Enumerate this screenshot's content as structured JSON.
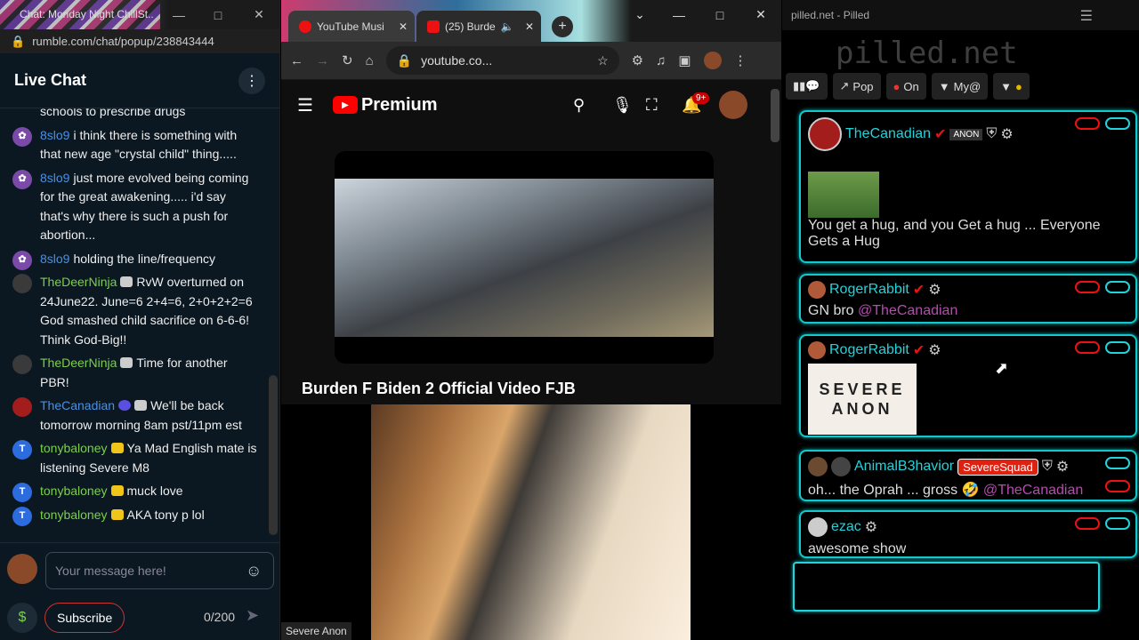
{
  "left": {
    "window_title": "Chat: Monday Night ChillSt...",
    "url": "rumble.com/chat/popup/238843444",
    "header": "Live Chat",
    "messages": [
      {
        "user": "",
        "text": "schools to prescribe drugs",
        "color": "#ffffff"
      },
      {
        "user": "8slo9",
        "text": "i think there is something with that new age \"crystal child\" thing.....",
        "color": "#4a90e2"
      },
      {
        "user": "8slo9",
        "text": "just more evolved being coming for the great awakening..... i'd say that's why there is such a push for abortion...",
        "color": "#4a90e2"
      },
      {
        "user": "8slo9",
        "text": "holding the line/frequency",
        "color": "#4a90e2"
      },
      {
        "user": "TheDeerNinja",
        "text": "RvW overturned on 24June22. June=6 2+4=6, 2+0+2+2=6 God smashed child sacrifice on 6-6-6! Think God-Big!!",
        "color": "#7bd04b"
      },
      {
        "user": "TheDeerNinja",
        "text": "Time for another PBR!",
        "color": "#7bd04b"
      },
      {
        "user": "TheCanadian",
        "text": "We'll be back tomorrow morning 8am pst/11pm est",
        "color": "#4a90e2"
      },
      {
        "user": "tonybaloney",
        "text": "Ya Mad English mate is listening Severe M8",
        "color": "#7bd04b"
      },
      {
        "user": "tonybaloney",
        "text": "muck love",
        "color": "#7bd04b"
      },
      {
        "user": "tonybaloney",
        "text": "AKA tony p lol",
        "color": "#7bd04b"
      }
    ],
    "input_placeholder": "Your message here!",
    "subscribe": "Subscribe",
    "char_count": "0/200"
  },
  "middle": {
    "tab1": "YouTube Musi",
    "tab2": "(25) Burde",
    "url": "youtube.co...",
    "brand": "Premium",
    "notif_count": "9+",
    "video_title": "Burden F Biden 2 Official Video FJB"
  },
  "camera": {
    "label": "Severe Anon"
  },
  "right": {
    "window_title": "pilled.net - Pilled",
    "logo": "pilled.net",
    "buttons": [
      "Pop",
      "On",
      "My@"
    ],
    "cards": [
      {
        "user": "TheCanadian",
        "text": "You get a hug, and you Get a hug ... Everyone Gets a Hug",
        "badge": "ANON"
      },
      {
        "user": "RogerRabbit",
        "text": "GN bro",
        "mention": "@TheCanadian"
      },
      {
        "user": "RogerRabbit",
        "text": "",
        "image_text": "SEVERE ANON"
      },
      {
        "user": "AnimalB3havior",
        "text": "oh... the Oprah ... gross",
        "mention": "@TheCanadian",
        "tag": "SevereSquad"
      },
      {
        "user": "ezac",
        "text": "awesome show"
      }
    ]
  }
}
